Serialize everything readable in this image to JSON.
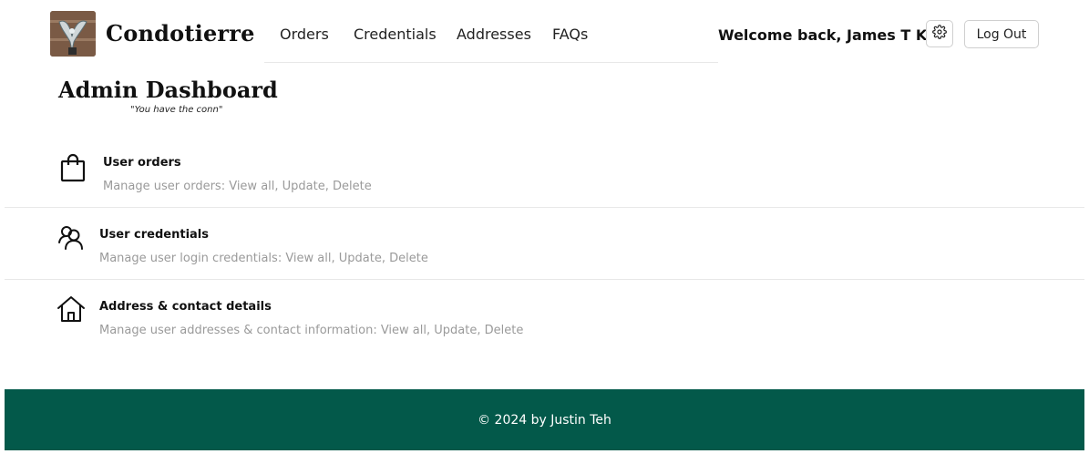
{
  "brand": {
    "name": "Condotierre",
    "logo": "condor-logo"
  },
  "nav": {
    "items": [
      {
        "label": "Orders"
      },
      {
        "label": "Credentials"
      },
      {
        "label": "Addresses"
      },
      {
        "label": "FAQs"
      }
    ]
  },
  "user": {
    "welcome": "Welcome back, James T Kirk",
    "settings_icon": "gear-icon",
    "logout_label": "Log Out"
  },
  "page": {
    "title": "Admin Dashboard",
    "subtitle": "\"You have the conn\""
  },
  "items": [
    {
      "icon": "shopping-bag-icon",
      "title": "User orders",
      "desc": "Manage user orders: View all, Update, Delete"
    },
    {
      "icon": "users-icon",
      "title": "User credentials",
      "desc": "Manage user login credentials: View all, Update, Delete"
    },
    {
      "icon": "house-icon",
      "title": "Address & contact details",
      "desc": "Manage user addresses & contact information: View all, Update, Delete"
    }
  ],
  "footer": {
    "text": "© 2024 by Justin Teh"
  },
  "colors": {
    "footer_bg": "#03594a",
    "muted_text": "#9a9a9a"
  }
}
